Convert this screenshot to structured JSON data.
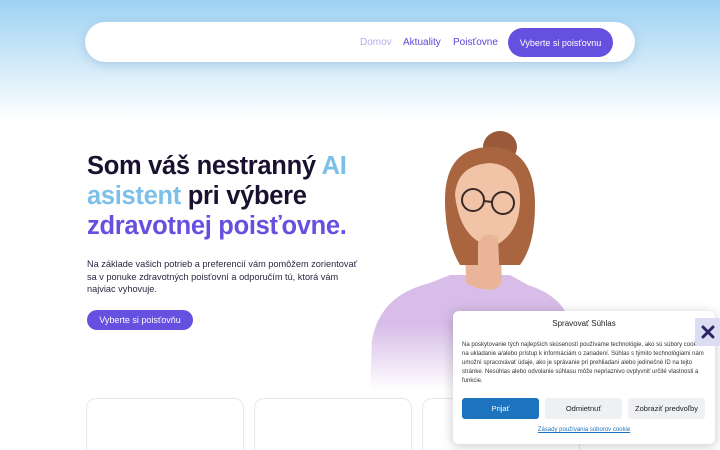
{
  "nav": {
    "home": "Domov",
    "news": "Aktuality",
    "insurance": "Poisťovne",
    "cta": "Vyberte si poisťovnu"
  },
  "hero": {
    "title_1": "Som váš nestranný ",
    "title_ai": "AI",
    "title_2": "asistent",
    "title_3": " pri výbere",
    "title_4": "zdravotnej poisťovne.",
    "text": "Na základe vašich potrieb a preferencií vám pomôžem zorientovať sa v ponuke zdravotných poisťovní a odporučím tú, ktorá vám najviac vyhovuje.",
    "button": "Vyberte si poisťovňu"
  },
  "cookie": {
    "title": "Spravovať Súhlas",
    "text": "Na poskytovanie tých najlepších skúseností používame technológie, ako sú súbory cookie na ukladanie a/alebo prístup k informáciám o zariadení. Súhlas s týmito technológiami nám umožní spracovávať údaje, ako je správanie pri prehliadaní alebo jedinečné ID na tejto stránke. Nesúhlas alebo odvolanie súhlasu môže nepriaznivo ovplyvniť určité vlastnosti a funkcie.",
    "accept": "Prijať",
    "deny": "Odmietnuť",
    "preferences": "Zobraziť predvoľby",
    "policy_link": "Zásady používania súborov cookie"
  },
  "icons": {
    "close": "close-icon",
    "person": "person-photo"
  },
  "colors": {
    "accent": "#6650e0",
    "light_accent": "#7cc0ea",
    "cookie_blue": "#1e73be"
  }
}
